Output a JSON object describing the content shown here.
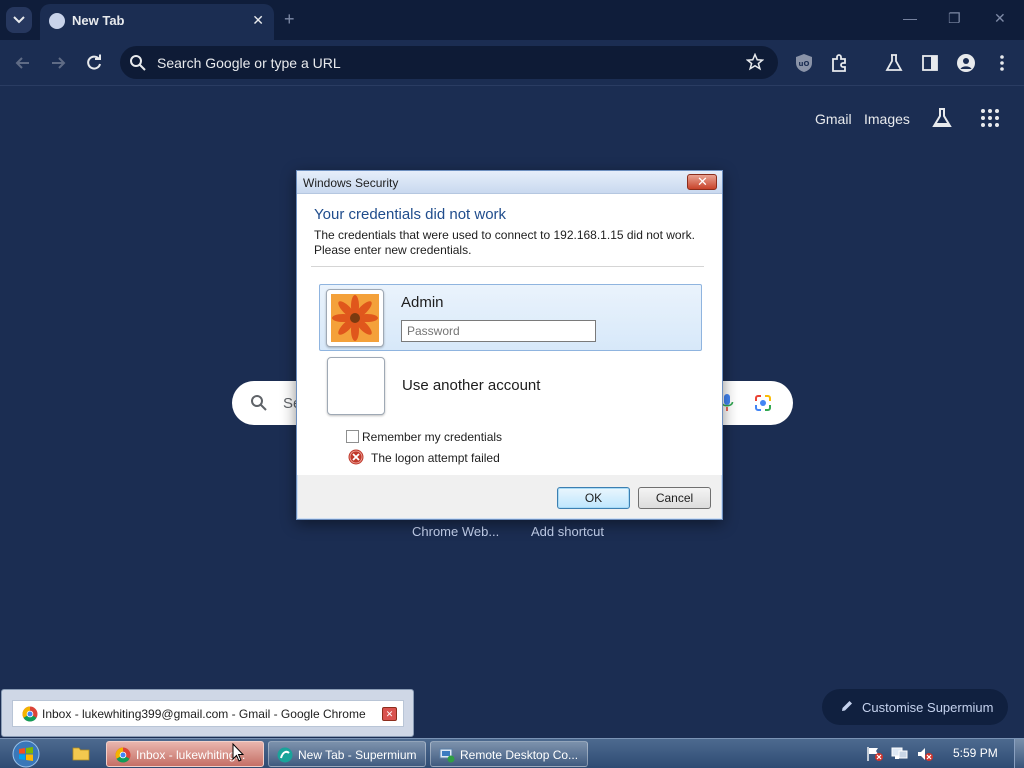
{
  "browser": {
    "tab_title": "New Tab",
    "tab_close": "✕",
    "new_tab": "+",
    "window_min": "—",
    "window_restore": "❐",
    "window_close": "✕",
    "omnibox_placeholder": "Search Google or type a URL"
  },
  "ntp": {
    "gmail": "Gmail",
    "images": "Images",
    "search_placeholder": "Se",
    "shortcuts": [
      "Chrome Web...",
      "Add shortcut"
    ],
    "customise": "Customise Supermium"
  },
  "dialog": {
    "title": "Windows Security",
    "close": "✕",
    "heading": "Your credentials did not work",
    "message": "The credentials that were used to connect to 192.168.1.15 did not work. Please enter new credentials.",
    "account_name": "Admin",
    "password_placeholder": "Password",
    "other_account": "Use another account",
    "remember": "Remember my credentials",
    "error": "The logon attempt failed",
    "ok": "OK",
    "cancel": "Cancel"
  },
  "thumbnail": {
    "title": "Inbox - lukewhiting399@gmail.com - Gmail - Google Chrome",
    "close": "✕"
  },
  "taskbar": {
    "buttons": [
      "Inbox - lukewhiting...",
      "New Tab - Supermium",
      "Remote Desktop Co..."
    ],
    "clock": "5:59 PM"
  },
  "colors": {
    "ntp_background": "#1b2d52",
    "titlebar": "#0f1d3a",
    "dialog_heading": "#1f4c8c",
    "error_red": "#c0392b"
  }
}
